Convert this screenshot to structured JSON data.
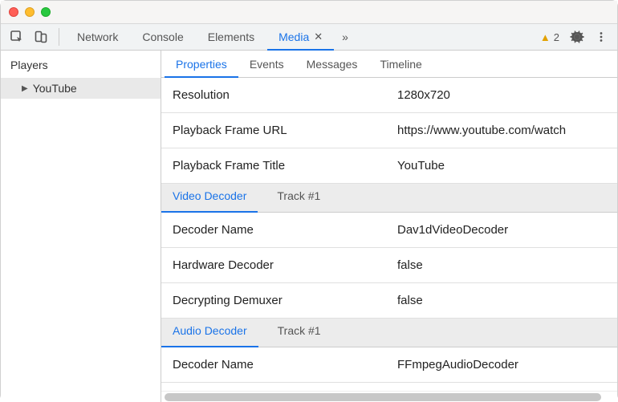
{
  "toolbar": {
    "tabs": [
      {
        "label": "Network",
        "selected": false,
        "close": false
      },
      {
        "label": "Console",
        "selected": false,
        "close": false
      },
      {
        "label": "Elements",
        "selected": false,
        "close": false
      },
      {
        "label": "Media",
        "selected": true,
        "close": true
      }
    ],
    "overflow": "»",
    "warning_count": "2"
  },
  "sidebar": {
    "title": "Players",
    "items": [
      {
        "label": "YouTube"
      }
    ]
  },
  "subtabs": [
    {
      "label": "Properties",
      "selected": true
    },
    {
      "label": "Events",
      "selected": false
    },
    {
      "label": "Messages",
      "selected": false
    },
    {
      "label": "Timeline",
      "selected": false
    }
  ],
  "sections": [
    {
      "type": "rows",
      "rows": [
        {
          "key": "Resolution",
          "value": "1280x720"
        },
        {
          "key": "Playback Frame URL",
          "value": "https://www.youtube.com/watch"
        },
        {
          "key": "Playback Frame Title",
          "value": "YouTube"
        }
      ]
    },
    {
      "type": "header",
      "tab": "Video Decoder",
      "info": "Track #1"
    },
    {
      "type": "rows",
      "rows": [
        {
          "key": "Decoder Name",
          "value": "Dav1dVideoDecoder"
        },
        {
          "key": "Hardware Decoder",
          "value": "false"
        },
        {
          "key": "Decrypting Demuxer",
          "value": "false"
        }
      ]
    },
    {
      "type": "header",
      "tab": "Audio Decoder",
      "info": "Track #1"
    },
    {
      "type": "rows",
      "rows": [
        {
          "key": "Decoder Name",
          "value": "FFmpegAudioDecoder"
        }
      ]
    }
  ]
}
